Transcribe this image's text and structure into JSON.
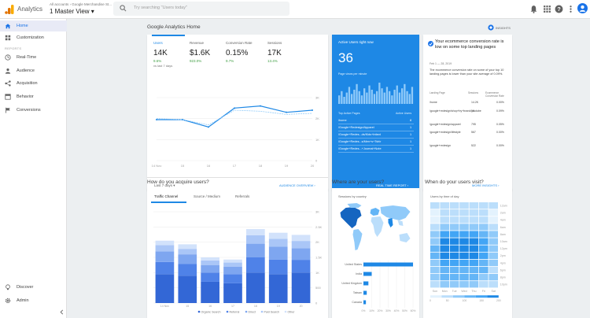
{
  "topbar": {
    "app_title": "Analytics",
    "account_path": "All accounts › Google Merchandise St...",
    "view_name": "1 Master View ▾",
    "search_placeholder": "Try searching \"Users today\""
  },
  "sidebar": {
    "items": [
      {
        "label": "Home",
        "icon": "home-icon",
        "active": true
      },
      {
        "label": "Customization",
        "icon": "grid-icon"
      }
    ],
    "reports_label": "REPORTS",
    "reports": [
      {
        "label": "Real-Time",
        "icon": "clock-icon"
      },
      {
        "label": "Audience",
        "icon": "person-icon"
      },
      {
        "label": "Acquisition",
        "icon": "acquisition-icon"
      },
      {
        "label": "Behavior",
        "icon": "behavior-icon"
      },
      {
        "label": "Conversions",
        "icon": "flag-icon"
      }
    ],
    "bottom": [
      {
        "label": "Discover",
        "icon": "lightbulb-icon"
      },
      {
        "label": "Admin",
        "icon": "gear-icon"
      }
    ]
  },
  "home": {
    "title": "Google Analytics Home",
    "insights_label": "INSIGHTS",
    "metrics": [
      {
        "name": "Users",
        "value": "14K",
        "change": "9.6%",
        "note": "vs last 7 days"
      },
      {
        "name": "Revenue",
        "value": "$1.6K",
        "change": "923.0%"
      },
      {
        "name": "Conversion Rate",
        "value": "0.15%",
        "change": "9.7%"
      },
      {
        "name": "Sessions",
        "value": "17K",
        "change": "13.4%"
      }
    ],
    "range_label": "Last 7 days ▾",
    "overview_link": "AUDIENCE OVERVIEW ›"
  },
  "chart_data": [
    {
      "type": "line",
      "x": [
        "14 Nov",
        "15",
        "16",
        "17",
        "18",
        "19",
        "20"
      ],
      "series": [
        {
          "values": [
            1.95,
            1.95,
            1.6,
            2.5,
            2.6,
            2.3,
            2.4
          ],
          "color": "#1e88e5"
        },
        {
          "values": [
            2.0,
            1.95,
            1.7,
            2.4,
            2.35,
            2.2,
            2.25
          ],
          "color": "#90caf9",
          "dashed": true
        }
      ],
      "yticks": [
        "3K",
        "2K",
        "1K",
        "0"
      ],
      "ylim": [
        0,
        3
      ]
    },
    {
      "type": "bar",
      "stacked": true,
      "x": [
        "14 Nov",
        "15",
        "16",
        "17",
        "18",
        "19",
        "20"
      ],
      "series": [
        {
          "name": "Organic Search",
          "values": [
            950,
            900,
            700,
            650,
            1000,
            950,
            1000
          ],
          "color": "#3367d6"
        },
        {
          "name": "Referral",
          "values": [
            400,
            380,
            300,
            300,
            500,
            480,
            420
          ],
          "color": "#4f82e8"
        },
        {
          "name": "Direct",
          "values": [
            350,
            320,
            250,
            240,
            450,
            420,
            380
          ],
          "color": "#7ea6f0"
        },
        {
          "name": "Paid Search",
          "values": [
            200,
            180,
            150,
            140,
            280,
            260,
            240
          ],
          "color": "#aac6f7"
        },
        {
          "name": "Other",
          "values": [
            150,
            150,
            100,
            100,
            200,
            200,
            200
          ],
          "color": "#d2e2fb"
        }
      ],
      "yticks": [
        "3K",
        "2.5K",
        "2K",
        "1.5K",
        "1K",
        "500",
        "0"
      ],
      "ylim": [
        0,
        3000
      ]
    },
    {
      "type": "bar",
      "orientation": "horizontal",
      "categories": [
        "United States",
        "India",
        "United Kingdom",
        "Taiwan",
        "Canada"
      ],
      "values": [
        60,
        10,
        6,
        4,
        3
      ],
      "xticks": [
        "0%",
        "10%",
        "20%",
        "30%",
        "40%",
        "50%",
        "60%"
      ],
      "xlim": [
        0,
        60
      ]
    },
    {
      "type": "heatmap",
      "title": "Users by time of day",
      "columns": [
        "Sun",
        "Mon",
        "Tue",
        "Wed",
        "Thu",
        "Fri",
        "Sat"
      ],
      "rows": [
        "12am",
        "2am",
        "4am",
        "6am",
        "8am",
        "10am",
        "12pm",
        "2pm",
        "4pm",
        "6pm",
        "8pm",
        "10pm"
      ],
      "scale_ticks": [
        "0",
        "50",
        "100",
        "150",
        "200"
      ]
    }
  ],
  "realtime": {
    "title": "Active Users right now",
    "value": "36",
    "pv_label": "Page views per minute",
    "table_headers": [
      "Top Active Pages",
      "Active Users"
    ],
    "rows": [
      {
        "page": "/home",
        "users": "8"
      },
      {
        "page": "/Google+Redesign/Apparel",
        "users": "1"
      },
      {
        "page": "/Google+Redes...ds/Kids+Infant",
        "users": "1"
      },
      {
        "page": "/Google+Redes...s/Men+s+Tshir",
        "users": "1"
      },
      {
        "page": "/Google+Redes...+Journal+Note",
        "users": "1"
      }
    ],
    "link": "REAL TIME REPORT ›"
  },
  "insight": {
    "title": "Your ecommerce conversion rate is low on some top landing pages",
    "date": "Feb 1 — 28, 2019",
    "body": "The ecommerce conversion rate on some of your top 10 landing pages is lower than your site average of 0.09%.",
    "headers": [
      "Landing Page",
      "Sessions",
      "Ecommerce Conversion Rate"
    ],
    "rows": [
      {
        "page": "/home",
        "sessions": "14.2K",
        "rate": "0.00%"
      },
      {
        "page": "/google+redesign/shop+by+brand/youtube",
        "sessions": "1K",
        "rate": "0.09%"
      },
      {
        "page": "/google+redesign/apparel",
        "sessions": "795",
        "rate": "0.05%"
      },
      {
        "page": "/google+redesign/lifestyle",
        "sessions": "567",
        "rate": "0.00%"
      },
      {
        "page": "/google+redesign",
        "sessions": "522",
        "rate": "0.00%"
      }
    ],
    "link": "MORE INSIGHTS ›"
  },
  "acquire": {
    "title": "How do you acquire users?",
    "tabs": [
      "Traffic Channel",
      "Source / Medium",
      "Referrals"
    ]
  },
  "where": {
    "title": "Where are your users?",
    "card_title": "Sessions by country"
  },
  "when": {
    "title": "When do your users visit?"
  }
}
